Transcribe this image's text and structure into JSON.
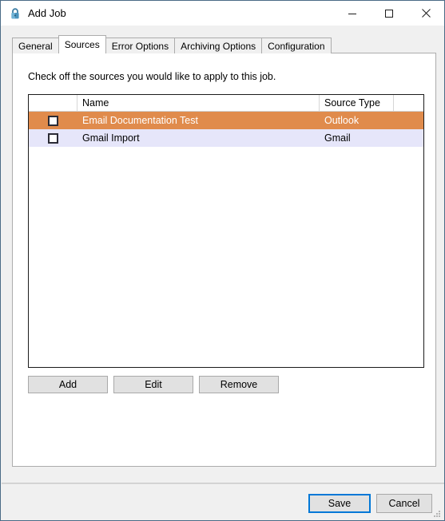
{
  "window": {
    "title": "Add Job",
    "icon": "lock-icon",
    "controls": {
      "minimize": "minimize-icon",
      "maximize": "maximize-icon",
      "close": "close-icon"
    }
  },
  "tabs": [
    {
      "label": "General",
      "active": false
    },
    {
      "label": "Sources",
      "active": true
    },
    {
      "label": "Error Options",
      "active": false
    },
    {
      "label": "Archiving Options",
      "active": false
    },
    {
      "label": "Configuration",
      "active": false
    }
  ],
  "main": {
    "instruction": "Check off the sources you would like to apply to this job.",
    "grid": {
      "columns": [
        "",
        "Name",
        "Source Type",
        ""
      ],
      "rows": [
        {
          "checked": false,
          "name": "Email Documentation Test",
          "source_type": "Outlook",
          "selected": true
        },
        {
          "checked": false,
          "name": "Gmail Import",
          "source_type": "Gmail",
          "selected": false
        }
      ]
    },
    "actions": {
      "add": "Add",
      "edit": "Edit",
      "remove": "Remove"
    }
  },
  "footer": {
    "save": "Save",
    "cancel": "Cancel"
  },
  "colors": {
    "selected_row": "#e08b4c",
    "alt_row": "#e6e6fa",
    "default_button_focus": "#0078d7",
    "window_border": "#4a6b86",
    "dialog_background": "#f0f0f0"
  }
}
